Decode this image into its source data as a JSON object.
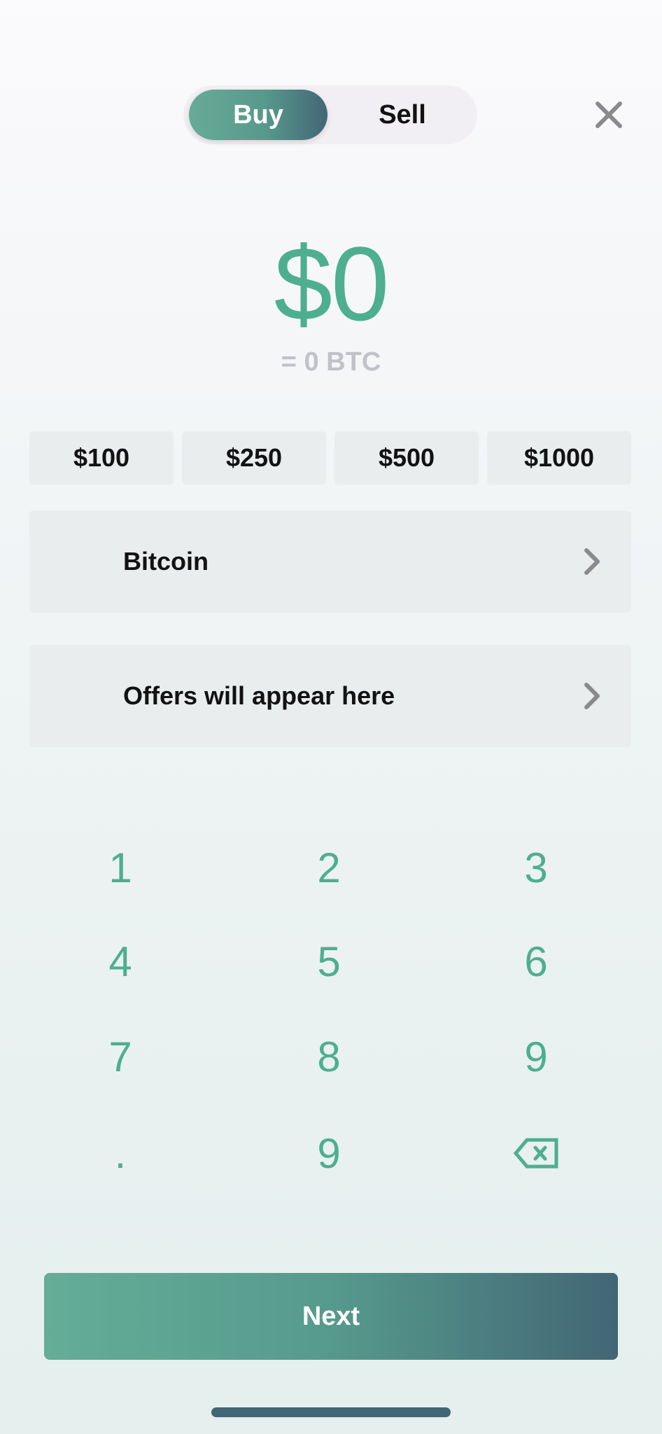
{
  "toggle": {
    "buy_label": "Buy",
    "sell_label": "Sell",
    "active": "Buy"
  },
  "amount": {
    "value": "$0",
    "converted": "= 0 BTC"
  },
  "presets": [
    "$100",
    "$250",
    "$500",
    "$1000"
  ],
  "asset_row": {
    "label": "Bitcoin",
    "icon": "chevron-right-icon"
  },
  "offers_row": {
    "label": "Offers will appear here",
    "icon": "chevron-right-icon"
  },
  "keypad": {
    "keys": [
      "1",
      "2",
      "3",
      "4",
      "5",
      "6",
      "7",
      "8",
      "9",
      ".",
      "9"
    ],
    "backspace_icon": "backspace-icon"
  },
  "next_label": "Next",
  "colors": {
    "accent": "#4daf8f",
    "gradient_start": "#66ab96",
    "gradient_end": "#426675",
    "surface": "#e9edee",
    "muted_text": "#c2c0c8"
  }
}
